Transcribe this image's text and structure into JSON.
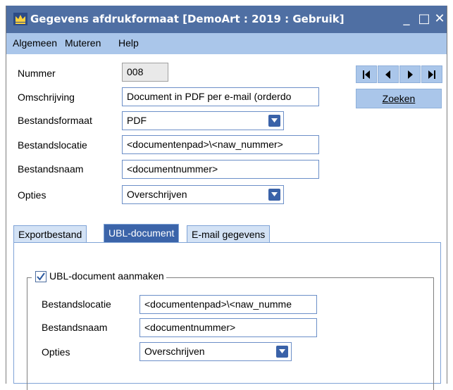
{
  "window": {
    "title": "Gegevens afdrukformaat  [DemoArt : 2019 : Gebruik]",
    "minimize": "_",
    "maximize": "□",
    "close": "✕"
  },
  "menu": {
    "items": [
      "Algemeen",
      "Muteren",
      "Help"
    ]
  },
  "form": {
    "nummer": {
      "label": "Nummer",
      "value": "008"
    },
    "omschrijving": {
      "label": "Omschrijving",
      "value": "Document in PDF per e-mail (orderdo"
    },
    "bestandsformaat": {
      "label": "Bestandsformaat",
      "value": "PDF"
    },
    "bestandslocatie": {
      "label": "Bestandslocatie",
      "value": "<documentenpad>\\<naw_nummer>"
    },
    "bestandsnaam": {
      "label": "Bestandsnaam",
      "value": "<documentnummer>"
    },
    "opties": {
      "label": "Opties",
      "value": "Overschrijven"
    }
  },
  "nav": {
    "search_label": "Zoeken"
  },
  "tabs": [
    {
      "label": "Exportbestand",
      "active": false
    },
    {
      "label": "UBL-document",
      "active": true
    },
    {
      "label": "E-mail gegevens",
      "active": false
    }
  ],
  "ubl": {
    "checkbox_label": "UBL-document aanmaken",
    "checked": true,
    "bestandslocatie": {
      "label": "Bestandslocatie",
      "value": "<documentenpad>\\<naw_numme"
    },
    "bestandsnaam": {
      "label": "Bestandsnaam",
      "value": "<documentnummer>"
    },
    "opties": {
      "label": "Opties",
      "value": "Overschrijven"
    }
  },
  "colors": {
    "titlebar": "#4f6fa3",
    "menubar": "#aac6ea",
    "active_tab": "#3b64a9",
    "field_border": "#6c8fc8"
  }
}
